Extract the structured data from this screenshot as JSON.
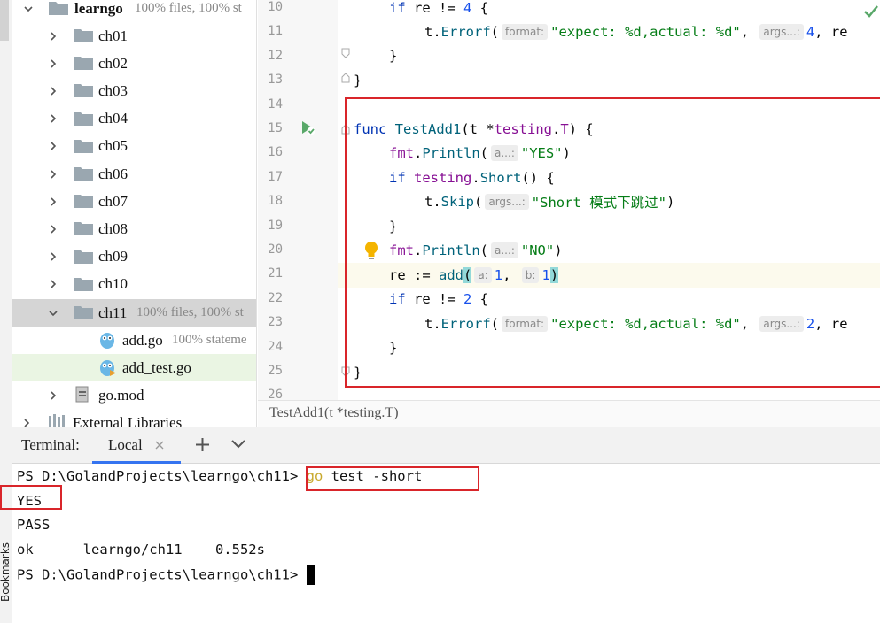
{
  "left_strip": {
    "bookmarks_label": "Bookmarks"
  },
  "tree": {
    "root": {
      "name": "learngo",
      "coverage": "100% files, 100% st"
    },
    "folders": [
      "ch01",
      "ch02",
      "ch03",
      "ch04",
      "ch05",
      "ch06",
      "ch07",
      "ch08",
      "ch09",
      "ch10"
    ],
    "ch11": {
      "name": "ch11",
      "coverage": "100% files, 100% st"
    },
    "files": [
      {
        "name": "add.go",
        "coverage": "100% stateme"
      },
      {
        "name": "add_test.go",
        "coverage": ""
      }
    ],
    "gomod": "go.mod",
    "external": "External Libraries"
  },
  "editor": {
    "line_numbers": [
      "10",
      "11",
      "12",
      "13",
      "14",
      "15",
      "16",
      "17",
      "18",
      "19",
      "20",
      "21",
      "22",
      "23",
      "24",
      "25",
      "26"
    ],
    "hints": {
      "format": "format:",
      "args": "args...:",
      "a_dots": "a...:",
      "a": "a:",
      "b": "b:"
    },
    "code": {
      "l10": {
        "kw": "if",
        "rest": " re != ",
        "num": "4",
        "end": " {"
      },
      "l11": {
        "recv": "t.",
        "fn": "Errorf",
        "open": "(",
        "str": "\"expect: %d,actual: %d\"",
        "sep": ", ",
        "num": "4",
        "tail": ", re"
      },
      "l12": "}",
      "l13": "}",
      "l15": {
        "kw": "func",
        "fn": "TestAdd1",
        "params1": "(t *",
        "pkg": "testing",
        "dot": ".",
        "type": "T",
        "params2": ") {"
      },
      "l16": {
        "pkg": "fmt",
        "dot": ".",
        "fn": "Println",
        "open": "(",
        "str": "\"YES\"",
        "close": ")"
      },
      "l17": {
        "kw": "if",
        "pkg": "testing",
        "dot": ".",
        "fn": "Short",
        "rest": "() {"
      },
      "l18": {
        "recv": "t.",
        "fn": "Skip",
        "open": "(",
        "str": "\"Short 模式下跳过\"",
        "close": ")"
      },
      "l19": "}",
      "l20": {
        "pkg": "fmt",
        "dot": ".",
        "fn": "Println",
        "open": "(",
        "str": "\"NO\"",
        "close": ")"
      },
      "l21": {
        "pre": "re := ",
        "fn": "add",
        "open": "(",
        "num1": "1",
        "sep": ", ",
        "num2": "1",
        "close": ")"
      },
      "l22": {
        "kw": "if",
        "rest": " re != ",
        "num": "2",
        "end": " {"
      },
      "l23": {
        "recv": "t.",
        "fn": "Errorf",
        "open": "(",
        "str": "\"expect: %d,actual: %d\"",
        "sep": ", ",
        "num": "2",
        "tail": ", re"
      },
      "l24": "}",
      "l25": "}"
    },
    "breadcrumb": "TestAdd1(t *testing.T)"
  },
  "terminal": {
    "title": "Terminal:",
    "tab": "Local",
    "prompt": "PS D:\\GolandProjects\\learngo\\ch11>",
    "cmd_go": "go",
    "cmd_rest": " test -short",
    "out1": "YES",
    "out2": "PASS",
    "out3": "ok      learngo/ch11    0.552s",
    "prompt2": "PS D:\\GolandProjects\\learngo\\ch11>"
  },
  "colors": {
    "highlight_red": "#d9252a",
    "keyword": "#0033b3",
    "string": "#067d17",
    "number": "#1750eb",
    "function": "#00627a"
  }
}
